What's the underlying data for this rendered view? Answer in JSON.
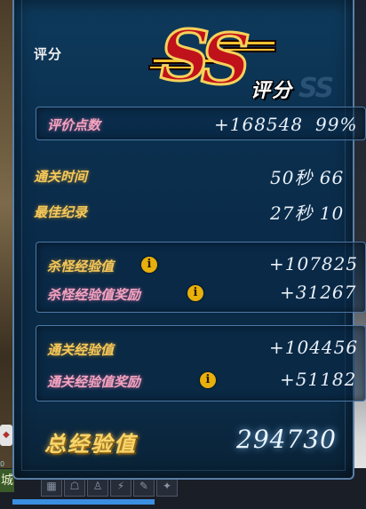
{
  "panel": {
    "title": "评分",
    "grade_letters": "SS",
    "grade_label": "评分",
    "rating_points": {
      "label": "评价点数",
      "value": "+168548",
      "percent": "99%"
    },
    "clear_time": {
      "label": "通关时间",
      "value": "50秒 66"
    },
    "best_record": {
      "label": "最佳纪录",
      "value": "27秒 10"
    },
    "kill_exp": {
      "label": "杀怪经验值",
      "value": "+107825"
    },
    "kill_exp_bonus": {
      "label": "杀怪经验值奖励",
      "value": "+31267"
    },
    "clear_exp": {
      "label": "通关经验值",
      "value": "+104456"
    },
    "clear_exp_bonus": {
      "label": "通关经验值奖励",
      "value": "+51182"
    },
    "total_exp": {
      "label": "总经验值",
      "value": "294730"
    },
    "info_icon_glyph": "i"
  },
  "colors": {
    "accent_gold": "#f5c85a",
    "accent_pink": "#f2a4c0",
    "grade_red": "#c0121a"
  },
  "side": {
    "left_char": "城",
    "left_num": "0"
  }
}
